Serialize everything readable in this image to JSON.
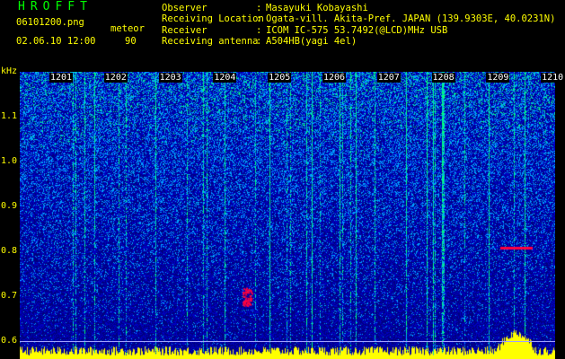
{
  "header": {
    "title": "HROFFT",
    "file_name": "06101200.png",
    "mode": "meteor",
    "datetime": "02.06.10 12:00",
    "count": "90",
    "info": [
      {
        "label": "Observer",
        "value": "Masayuki Kobayashi"
      },
      {
        "label": "Receiving Location",
        "value": "Ogata-vill. Akita-Pref. JAPAN (139.9303E, 40.0231N)"
      },
      {
        "label": "Receiver",
        "value": "ICOM IC-575 53.7492(@LCD)MHz USB"
      },
      {
        "label": "Receiving antenna",
        "value": "A504HB(yagi 4el)"
      }
    ]
  },
  "spectrogram": {
    "y_unit": "kHz",
    "y_ticks": [
      "1.1",
      "1.0",
      "0.9",
      "0.8",
      "0.7",
      "0.6"
    ],
    "y_values": [
      1.1,
      1.0,
      0.9,
      0.8,
      0.7,
      0.6
    ],
    "y_range": [
      0.56,
      1.2
    ],
    "minute_labels": [
      "1201",
      "1202",
      "1203",
      "1204",
      "1205",
      "1206",
      "1207",
      "1208",
      "1209",
      "1210"
    ],
    "colors": {
      "background": "#000080",
      "low": "#0000c0",
      "mid": "#00a0ff",
      "high": "#00ff80",
      "peak": "#ff0040",
      "power_trace": "#ffff00",
      "text": "#ffff00"
    }
  }
}
